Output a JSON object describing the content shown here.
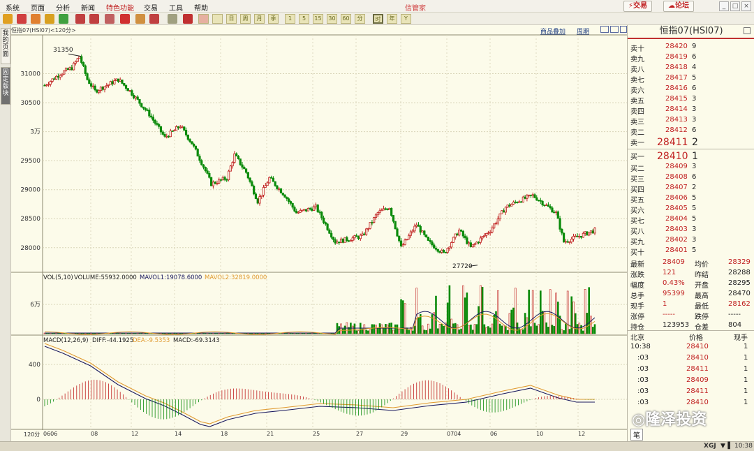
{
  "menu": {
    "items": [
      "系统",
      "页面",
      "分析",
      "新闻",
      "特色功能",
      "交易",
      "工具",
      "帮助"
    ],
    "app_title": "信管家",
    "trade_btn": "交易",
    "forum_btn": "论坛"
  },
  "toolbar": {
    "periods": [
      "日",
      "周",
      "月",
      "季",
      "年",
      "1",
      "5",
      "15",
      "30",
      "60",
      "分",
      "时",
      "Y"
    ]
  },
  "lefttabs": {
    "tab1": "我的页面",
    "tab2": "固定版块"
  },
  "header": {
    "symbol": "恒指07(HSI07)<120分>",
    "overlay": "商品叠加",
    "period": "周期"
  },
  "main_chart": {
    "yticks": [
      "31000",
      "30500",
      "3万",
      "29500",
      "29000",
      "28500",
      "28000"
    ],
    "high_label": "31350",
    "low_label": "27720"
  },
  "volume": {
    "label": "VOL(5,10)",
    "volume": "VOLUME:55932.0000",
    "mavol1": "MAVOL1:19078.6000",
    "mavol2": "MAVOL2:32819.0000",
    "ytick": "6万"
  },
  "macd": {
    "label": "MACD(12,26,9)",
    "diff": "DIFF:-44.1925",
    "dea": "DEA:-9.5353",
    "macd": "MACD:-69.3143",
    "yticks": [
      "400",
      "0"
    ]
  },
  "xaxis": {
    "period_label": "120分",
    "ticks": [
      "0606",
      "08",
      "12",
      "14",
      "18",
      "21",
      "25",
      "27",
      "29",
      "0704",
      "06",
      "10",
      "12"
    ]
  },
  "quote": {
    "title": "恒指07(HSI07)",
    "asks": [
      [
        "卖十",
        "28420",
        "9"
      ],
      [
        "卖九",
        "28419",
        "6"
      ],
      [
        "卖八",
        "28418",
        "4"
      ],
      [
        "卖七",
        "28417",
        "5"
      ],
      [
        "卖六",
        "28416",
        "6"
      ],
      [
        "卖五",
        "28415",
        "3"
      ],
      [
        "卖四",
        "28414",
        "3"
      ],
      [
        "卖三",
        "28413",
        "3"
      ],
      [
        "卖二",
        "28412",
        "6"
      ],
      [
        "卖一",
        "28411",
        "2"
      ]
    ],
    "bids": [
      [
        "买一",
        "28410",
        "1"
      ],
      [
        "买二",
        "28409",
        "3"
      ],
      [
        "买三",
        "28408",
        "6"
      ],
      [
        "买四",
        "28407",
        "2"
      ],
      [
        "买五",
        "28406",
        "5"
      ],
      [
        "买六",
        "28405",
        "5"
      ],
      [
        "买七",
        "28404",
        "5"
      ],
      [
        "买八",
        "28403",
        "3"
      ],
      [
        "买九",
        "28402",
        "3"
      ],
      [
        "买十",
        "28401",
        "5"
      ]
    ],
    "stats": [
      [
        "最新",
        "28409",
        "均价",
        "28329"
      ],
      [
        "涨跌",
        "121",
        "昨结",
        "28288"
      ],
      [
        "幅度",
        "0.43%",
        "开盘",
        "28295"
      ],
      [
        "总手",
        "95399",
        "最高",
        "28470"
      ],
      [
        "现手",
        "1",
        "最低",
        "28162"
      ],
      [
        "涨停",
        "-----",
        "跌停",
        "-----"
      ],
      [
        "持仓",
        "123953",
        "仓差",
        "804"
      ]
    ],
    "ticks_header": [
      "北京",
      "价格",
      "现手"
    ],
    "ticks": [
      [
        "10:38",
        "28410",
        "1"
      ],
      [
        ":03",
        "28410",
        "1"
      ],
      [
        ":03",
        "28411",
        "1"
      ],
      [
        ":03",
        "28409",
        "1"
      ],
      [
        ":03",
        "28411",
        "1"
      ],
      [
        ":03",
        "28410",
        "1"
      ]
    ],
    "footer_tab": "笔"
  },
  "status": {
    "time": "10:38",
    "brand": "XGJ"
  },
  "watermark": "隆泽投资",
  "colors": {
    "up": "#c02020",
    "down": "#0a8a0a",
    "diff": "#1a1a60",
    "dea": "#e09a30"
  }
}
